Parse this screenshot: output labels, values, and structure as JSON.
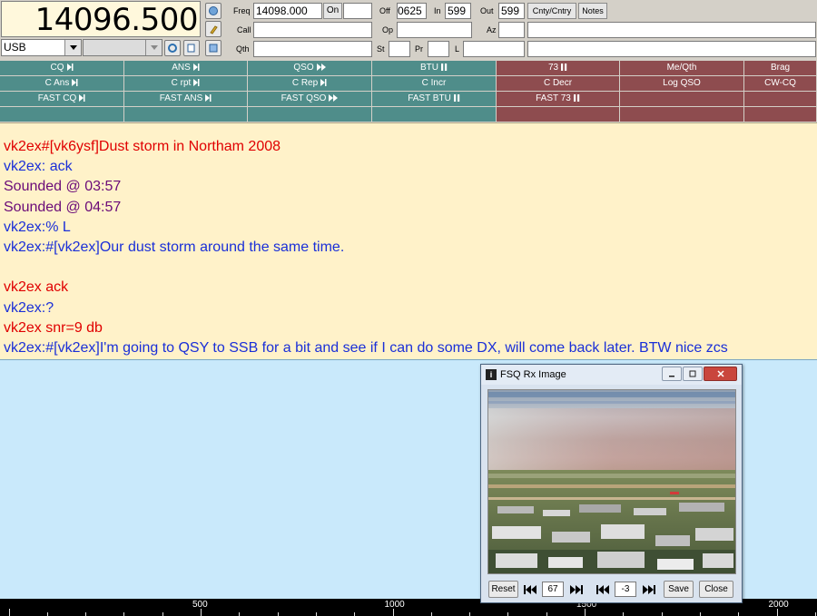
{
  "freq_display": "14096.500",
  "mode": "USB",
  "log": {
    "freq_label": "Freq",
    "freq_value": "14098.000",
    "on_label": "On",
    "on_value": "",
    "off_label": "Off",
    "off_value": "0625",
    "in_label": "In",
    "in_value": "599",
    "out_label": "Out",
    "out_value": "599",
    "cnty_button": "Cnty/Cntry",
    "notes_button": "Notes",
    "call_label": "Call",
    "call_value": "",
    "op_label": "Op",
    "op_value": "",
    "az_label": "Az",
    "az_value": "",
    "qth_label": "Qth",
    "qth_value": "",
    "st_label": "St",
    "pr_label": "Pr",
    "l_label": "L"
  },
  "macros": {
    "row1": [
      "CQ",
      "ANS",
      "QSO",
      "BTU",
      "73",
      "Me/Qth",
      "Brag"
    ],
    "row2": [
      "C Ans",
      "C rpt",
      "C Rep",
      "C Incr",
      "C Decr",
      "Log QSO",
      "CW-CQ"
    ],
    "row3": [
      "FAST CQ",
      "FAST ANS",
      "FAST QSO",
      "FAST BTU",
      "FAST 73",
      "",
      ""
    ],
    "row4": [
      "",
      "",
      "",
      "",
      "",
      "",
      ""
    ],
    "icons": {
      "row1": [
        "step-icon",
        "step-icon",
        "fast-forward-icon",
        "pause-icon",
        "pause-icon",
        "",
        ""
      ],
      "row2": [
        "step-icon",
        "step-icon",
        "step-icon",
        "",
        "",
        "",
        ""
      ],
      "row3": [
        "step-icon",
        "step-icon",
        "fast-forward-icon",
        "pause-icon",
        "pause-icon",
        "",
        ""
      ]
    },
    "colors": {
      "teal": "#4f8d8a",
      "red": "#8e4c4f"
    }
  },
  "rx_lines": [
    {
      "text": "vk2ex#[vk6ysf]Dust storm in Northam 2008",
      "color": "red"
    },
    {
      "text": "vk2ex: ack",
      "color": "blue"
    },
    {
      "text": "Sounded @ 03:57",
      "color": "purple"
    },
    {
      "text": "Sounded @ 04:57",
      "color": "purple"
    },
    {
      "text": "vk2ex:% L",
      "color": "blue"
    },
    {
      "text": "vk2ex:#[vk2ex]Our dust storm around the same time.",
      "color": "blue"
    },
    {
      "text": "",
      "color": "blue"
    },
    {
      "text": "vk2ex ack",
      "color": "red"
    },
    {
      "text": "vk2ex:?",
      "color": "blue"
    },
    {
      "text": "vk2ex snr=9 db",
      "color": "red"
    },
    {
      "text": "vk2ex:#[vk2ex]I'm going to QSY to SSB for a bit and see if I can do some DX, will come back later. BTW nice zcs",
      "color": "blue"
    }
  ],
  "waterfall_scale": {
    "labels": [
      "500",
      "1000",
      "1500",
      "2000"
    ]
  },
  "image_window": {
    "title": "FSQ Rx Image",
    "reset_button": "Reset",
    "value_left": "67",
    "value_right": "-3",
    "save_button": "Save",
    "close_button": "Close"
  }
}
